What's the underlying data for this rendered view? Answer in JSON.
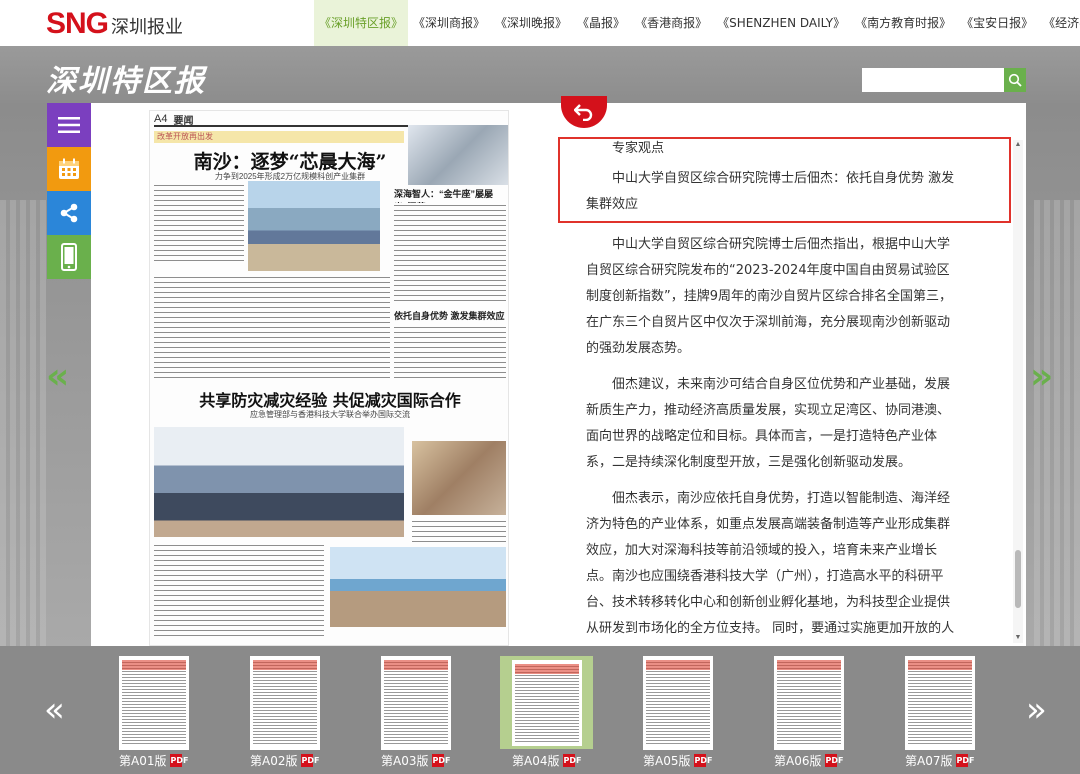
{
  "brand": {
    "logo_mark": "SNG",
    "logo_text": "深圳报业",
    "masthead": "深圳特区报"
  },
  "nav": [
    {
      "label": "《深圳特区报》",
      "active": true
    },
    {
      "label": "《深圳商报》",
      "active": false
    },
    {
      "label": "《深圳晚报》",
      "active": false
    },
    {
      "label": "《晶报》",
      "active": false
    },
    {
      "label": "《香港商报》",
      "active": false
    },
    {
      "label": "《SHENZHEN DAILY》",
      "active": false
    },
    {
      "label": "《南方教育时报》",
      "active": false
    },
    {
      "label": "《宝安日报》",
      "active": false
    },
    {
      "label": "《经济导报》",
      "active": false
    }
  ],
  "search": {
    "placeholder": "",
    "value": "",
    "icon": "search-icon"
  },
  "tools": [
    {
      "name": "menu-icon",
      "color": "#7b3fbf"
    },
    {
      "name": "calendar-icon",
      "color": "#f29a0f"
    },
    {
      "name": "share-icon",
      "color": "#2b86d9"
    },
    {
      "name": "mobile-icon",
      "color": "#6ab04c"
    }
  ],
  "paper": {
    "page": "A4",
    "section": "要闻",
    "bar_text": "改革开放再出发",
    "headline1": "南沙：逐梦“芯晨大海”",
    "sub1": "力争到2025年形成2万亿规模科创产业集群",
    "side_head1": "深海智人：“金牛座”屡屡出“深蓝”",
    "side_head2": "依托自身优势 激发集群效应",
    "headline2": "共享防灾减灾经验 共促减灾国际合作",
    "sub2": "应急管理部与香港科技大学联合举办国际交流"
  },
  "article": {
    "label": "专家观点",
    "subtitle": "中山大学自贸区综合研究院博士后佃杰：依托自身优势 激发集群效应",
    "paragraphs": [
      "中山大学自贸区综合研究院博士后佃杰指出，根据中山大学自贸区综合研究院发布的“2023-2024年度中国自由贸易试验区制度创新指数”，挂牌9周年的南沙自贸片区综合排名全国第三，在广东三个自贸片区中仅次于深圳前海，充分展现南沙创新驱动的强劲发展态势。",
      "佃杰建议，未来南沙可结合自身区位优势和产业基础，发展新质生产力，推动经济高质量发展，实现立足湾区、协同港澳、面向世界的战略定位和目标。具体而言，一是打造特色产业体系，二是持续深化制度型开放，三是强化创新驱动发展。",
      "佃杰表示，南沙应依托自身优势，打造以智能制造、海洋经济为特色的产业体系，如重点发展高端装备制造等产业形成集群效应，加大对深海科技等前沿领域的投入，培育未来产业增长点。南沙也应围绕香港科技大学（广州），打造高水平的科研平台、技术转移转化中心和创新创业孵化基地，为科技型企业提供从研发到市场化的全方位支持。 同时，要通过实施更加开放的人才政策，如提供优厚的科研条件和生活待遇，吸引更多海内外顶尖科学家和团队来南沙工作。"
    ]
  },
  "thumbs": [
    {
      "label": "第A01版",
      "active": false
    },
    {
      "label": "第A02版",
      "active": false
    },
    {
      "label": "第A03版",
      "active": false
    },
    {
      "label": "第A04版",
      "active": true
    },
    {
      "label": "第A05版",
      "active": false
    },
    {
      "label": "第A06版",
      "active": false
    },
    {
      "label": "第A07版",
      "active": false
    }
  ],
  "pdf_badge": "PDF",
  "colors": {
    "brand_red": "#d4111b",
    "accent_green": "#6ab04c",
    "highlight_border": "#e0322b"
  }
}
